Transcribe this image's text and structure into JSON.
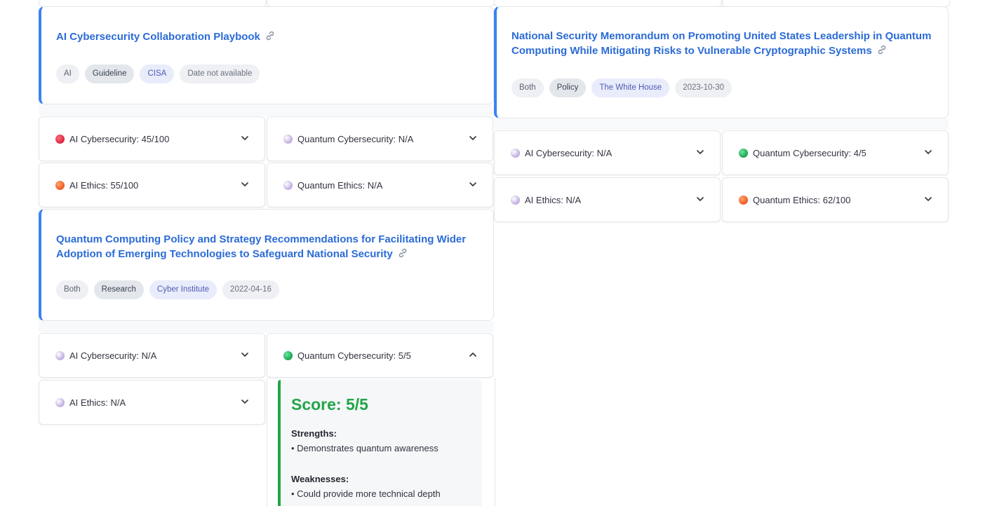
{
  "colors": {
    "accent_blue": "#3b82f6",
    "title_blue": "#2b6bd6",
    "score_green": "#22a547",
    "dot_red": "#d9243f",
    "dot_orange": "#ee5a24",
    "dot_green": "#16a34a",
    "dot_na": "#c7b6e3"
  },
  "documents": [
    {
      "title": "AI Cybersecurity Collaboration Playbook",
      "tags": {
        "domain": "AI",
        "type": "Guideline",
        "source": "CISA",
        "date": "Date not available"
      },
      "scores": {
        "ai_cyber": {
          "label": "AI Cybersecurity: 45/100",
          "status": "red",
          "expanded": false
        },
        "quantum_cyber": {
          "label": "Quantum Cybersecurity: N/A",
          "status": "na",
          "expanded": false
        },
        "ai_ethics": {
          "label": "AI Ethics: 55/100",
          "status": "orange",
          "expanded": false
        },
        "quantum_ethics": {
          "label": "Quantum Ethics: N/A",
          "status": "na",
          "expanded": false
        }
      }
    },
    {
      "title_line1": "National Security Memorandum on Promoting United States Leadership in Quantum",
      "title_line2": "Computing While Mitigating Risks to Vulnerable Cryptographic Systems",
      "tags": {
        "domain": "Both",
        "type": "Policy",
        "source": "The White House",
        "date": "2023-10-30"
      },
      "scores": {
        "ai_cyber": {
          "label": "AI Cybersecurity: N/A",
          "status": "na",
          "expanded": false
        },
        "quantum_cyber": {
          "label": "Quantum Cybersecurity: 4/5",
          "status": "green",
          "expanded": false
        },
        "ai_ethics": {
          "label": "AI Ethics: N/A",
          "status": "na",
          "expanded": false
        },
        "quantum_ethics": {
          "label": "Quantum Ethics: 62/100",
          "status": "orange",
          "expanded": false
        }
      }
    },
    {
      "title_line1": "Quantum Computing Policy and Strategy Recommendations for Facilitating Wider",
      "title_line2": "Adoption of Emerging Technologies to Safeguard National Security",
      "tags": {
        "domain": "Both",
        "type": "Research",
        "source": "Cyber Institute",
        "date": "2022-04-16"
      },
      "scores": {
        "ai_cyber": {
          "label": "AI Cybersecurity: N/A",
          "status": "na",
          "expanded": false
        },
        "quantum_cyber": {
          "label": "Quantum Cybersecurity: 5/5",
          "status": "green",
          "expanded": true
        },
        "ai_ethics": {
          "label": "AI Ethics: N/A",
          "status": "na",
          "expanded": false
        }
      },
      "detail": {
        "score": "Score: 5/5",
        "strengths_heading": "Strengths:",
        "strengths": [
          "• Demonstrates quantum awareness"
        ],
        "weaknesses_heading": "Weaknesses:",
        "weaknesses": [
          "• Could provide more technical depth"
        ]
      }
    }
  ]
}
